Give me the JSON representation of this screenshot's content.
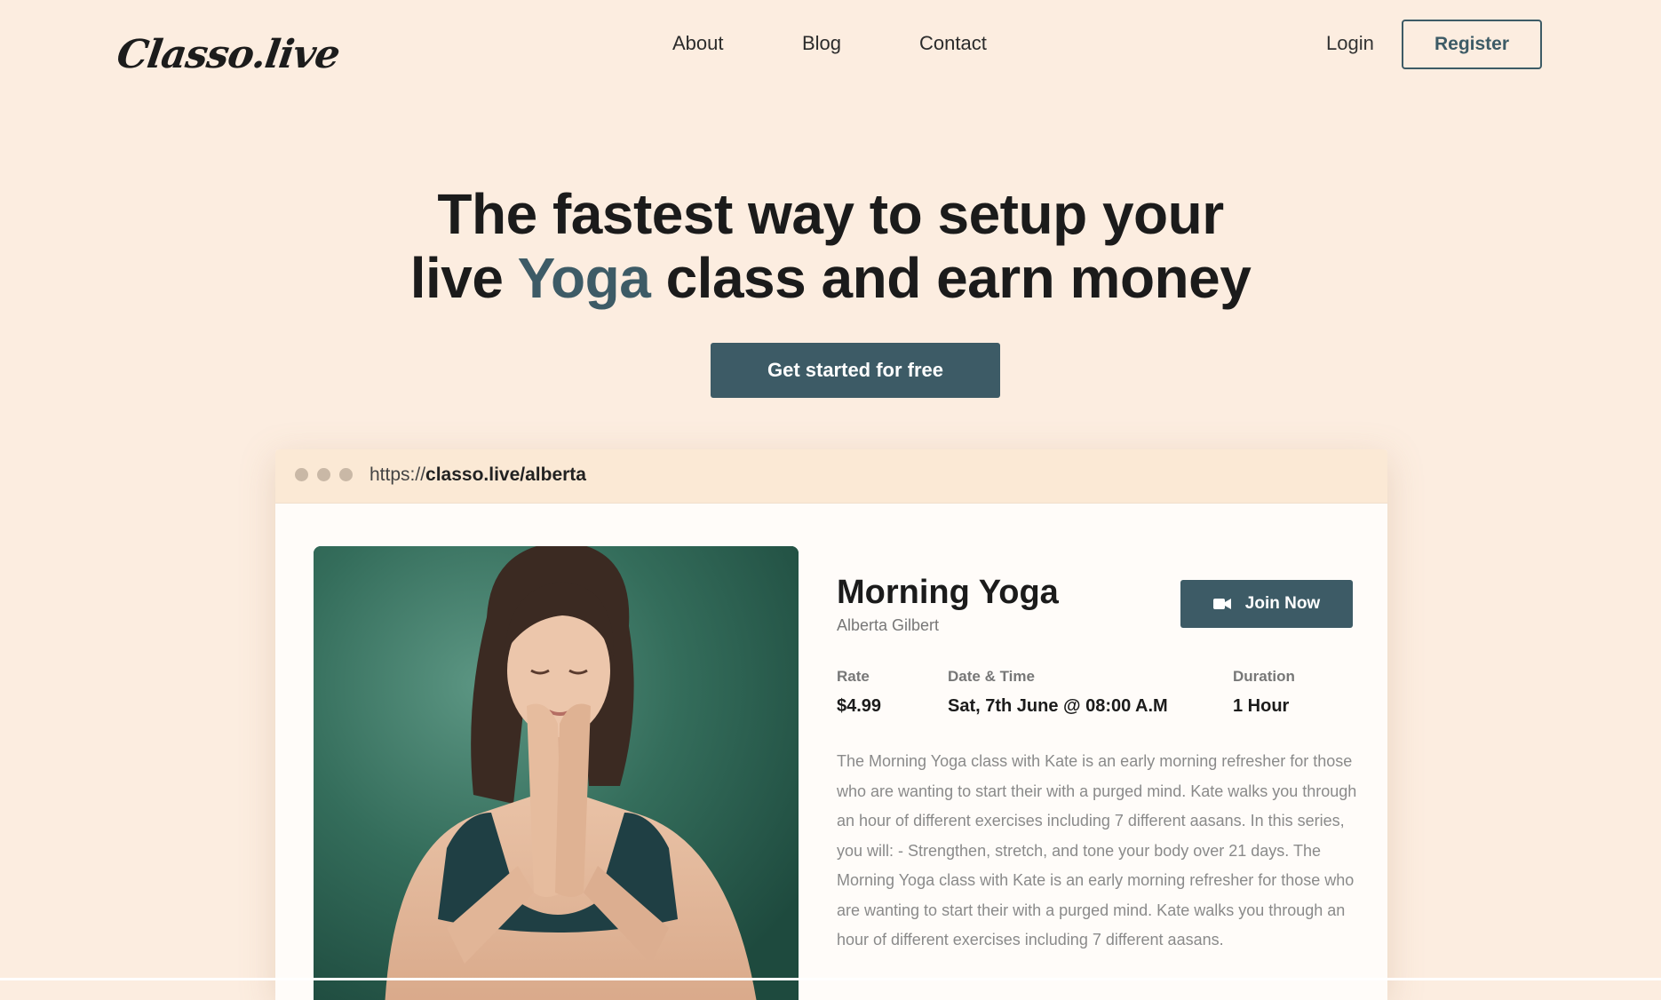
{
  "header": {
    "logo": "Classo.live",
    "nav": [
      "About",
      "Blog",
      "Contact"
    ],
    "login": "Login",
    "register": "Register"
  },
  "hero": {
    "line1": "The fastest way to setup your",
    "line2_start": "live ",
    "line2_accent": "Yoga",
    "line2_end": " class and earn money",
    "cta": "Get started for free"
  },
  "browser": {
    "url_protocol": "https://",
    "url_rest": "classo.live/alberta"
  },
  "class": {
    "title": "Morning Yoga",
    "instructor": "Alberta Gilbert",
    "join_label": "Join Now",
    "rate_label": "Rate",
    "rate_value": "$4.99",
    "datetime_label": "Date & Time",
    "datetime_value": "Sat, 7th June @ 08:00 A.M",
    "duration_label": "Duration",
    "duration_value": "1 Hour",
    "description": "The Morning Yoga class with Kate is an early morning refresher for those who are wanting to start their with a purged mind. Kate walks you through an hour of different exercises including 7 different aasans. In this series, you will: - Strengthen, stretch, and tone your body over 21 days. The Morning Yoga class with Kate is an early morning refresher for those who are wanting to start their with a purged mind. Kate walks you through an hour of different exercises including 7 different aasans."
  },
  "colors": {
    "background": "#fcede0",
    "accent": "#3d5b66",
    "text": "#1b1b1b"
  },
  "icons": {
    "join": "video-camera-icon",
    "window_dots": "window-control-dots"
  }
}
